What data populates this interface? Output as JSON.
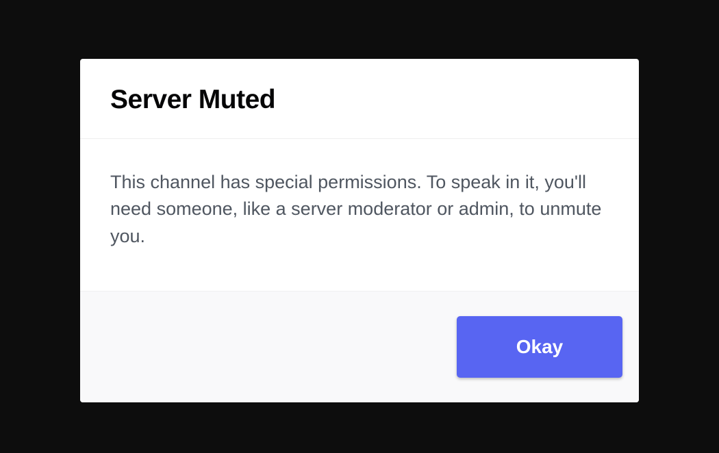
{
  "modal": {
    "title": "Server Muted",
    "message": "This channel has special permissions. To speak in it, you'll need someone, like a server moderator or admin, to unmute you.",
    "button_label": "Okay"
  },
  "colors": {
    "background": "#0d0d0d",
    "modal_bg": "#ffffff",
    "footer_bg": "#f9f9fa",
    "primary_button": "#5865f2",
    "title_text": "#060607",
    "body_text": "#4f5660"
  }
}
